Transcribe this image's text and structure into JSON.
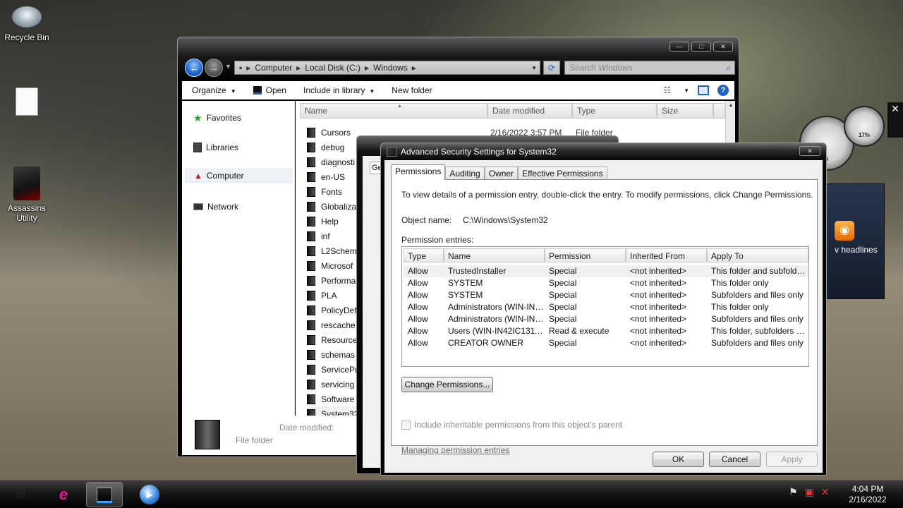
{
  "desktop": {
    "recycle_bin": "Recycle Bin",
    "assassins": "Assassins Utility"
  },
  "gadgets": {
    "close_glyph": "✕",
    "meter_right_pct": "17%",
    "meter_left_pct": "6",
    "feed_text": "v headlines",
    "rss_glyph": "◉"
  },
  "explorer": {
    "nav_back_glyph": "←",
    "nav_fwd_glyph": "→",
    "nav_dd_glyph": "▼",
    "breadcrumb": [
      "Computer",
      "Local Disk (C:)",
      "Windows"
    ],
    "breadcrumb_sep": "▶",
    "refresh_glyph": "⟳",
    "search_placeholder": "Search Windows",
    "search_icon_glyph": "⌕",
    "cmd": {
      "organize": "Organize",
      "open": "Open",
      "include": "Include in library",
      "new_folder": "New folder",
      "dropdown": "▼",
      "help": "?",
      "views": "☷"
    },
    "nav": {
      "favorites": "Favorites",
      "libraries": "Libraries",
      "computer": "Computer",
      "network": "Network",
      "star": "★",
      "warn": "▲"
    },
    "columns": {
      "name": "Name",
      "date": "Date modified",
      "type": "Type",
      "size": "Size",
      "sort_glyph": "▲"
    },
    "files": [
      {
        "name": "Cursors",
        "date": "2/16/2022 3:57 PM",
        "type": "File folder"
      },
      {
        "name": "debug"
      },
      {
        "name": "diagnosti"
      },
      {
        "name": "en-US"
      },
      {
        "name": "Fonts"
      },
      {
        "name": "Globaliza"
      },
      {
        "name": "Help"
      },
      {
        "name": "inf"
      },
      {
        "name": "L2Schem"
      },
      {
        "name": "Microsof"
      },
      {
        "name": "Performa"
      },
      {
        "name": "PLA"
      },
      {
        "name": "PolicyDef"
      },
      {
        "name": "rescache"
      },
      {
        "name": "Resource"
      },
      {
        "name": "schemas"
      },
      {
        "name": "ServicePr"
      },
      {
        "name": "servicing"
      },
      {
        "name": "Software"
      },
      {
        "name": "System32"
      }
    ],
    "details": {
      "date_label": "Date modified:",
      "type": "File folder"
    },
    "scroll_up": "▲"
  },
  "props": {
    "tab_partial": "Ge"
  },
  "advanced": {
    "title": "Advanced Security Settings for System32",
    "close_glyph": "✕",
    "tabs": [
      "Permissions",
      "Auditing",
      "Owner",
      "Effective Permissions"
    ],
    "instructions": "To view details of a permission entry, double-click the entry. To modify permissions, click Change Permissions.",
    "object_label": "Object name:",
    "object_value": "C:\\Windows\\System32",
    "entries_label": "Permission entries:",
    "columns": [
      "Type",
      "Name",
      "Permission",
      "Inherited From",
      "Apply To"
    ],
    "entries": [
      {
        "type": "Allow",
        "name": "TrustedInstaller",
        "permission": "Special",
        "inherited": "<not inherited>",
        "apply": "This folder and subfolders"
      },
      {
        "type": "Allow",
        "name": "SYSTEM",
        "permission": "Special",
        "inherited": "<not inherited>",
        "apply": "This folder only"
      },
      {
        "type": "Allow",
        "name": "SYSTEM",
        "permission": "Special",
        "inherited": "<not inherited>",
        "apply": "Subfolders and files only"
      },
      {
        "type": "Allow",
        "name": "Administrators (WIN-IN42I...",
        "permission": "Special",
        "inherited": "<not inherited>",
        "apply": "This folder only"
      },
      {
        "type": "Allow",
        "name": "Administrators (WIN-IN42I...",
        "permission": "Special",
        "inherited": "<not inherited>",
        "apply": "Subfolders and files only"
      },
      {
        "type": "Allow",
        "name": "Users (WIN-IN42IC1311V...",
        "permission": "Read & execute",
        "inherited": "<not inherited>",
        "apply": "This folder, subfolders and..."
      },
      {
        "type": "Allow",
        "name": "CREATOR OWNER",
        "permission": "Special",
        "inherited": "<not inherited>",
        "apply": "Subfolders and files only"
      }
    ],
    "change_button": "Change Permissions...",
    "include_checkbox": "Include inheritable permissions from this object's parent",
    "include_checked": false,
    "manage_link": "Managing permission entries",
    "ok": "OK",
    "cancel": "Cancel",
    "apply": "Apply"
  },
  "taskbar": {
    "start_glyph": "⊞",
    "ie_glyph": "e",
    "wmp_glyph": "▶",
    "tray_flag": "⚑",
    "tray_network": "▣",
    "tray_volume": "✕",
    "time": "4:04 PM",
    "date": "2/16/2022"
  },
  "colors": {
    "accent": "#1d63c9",
    "ie": "#e0198c"
  }
}
